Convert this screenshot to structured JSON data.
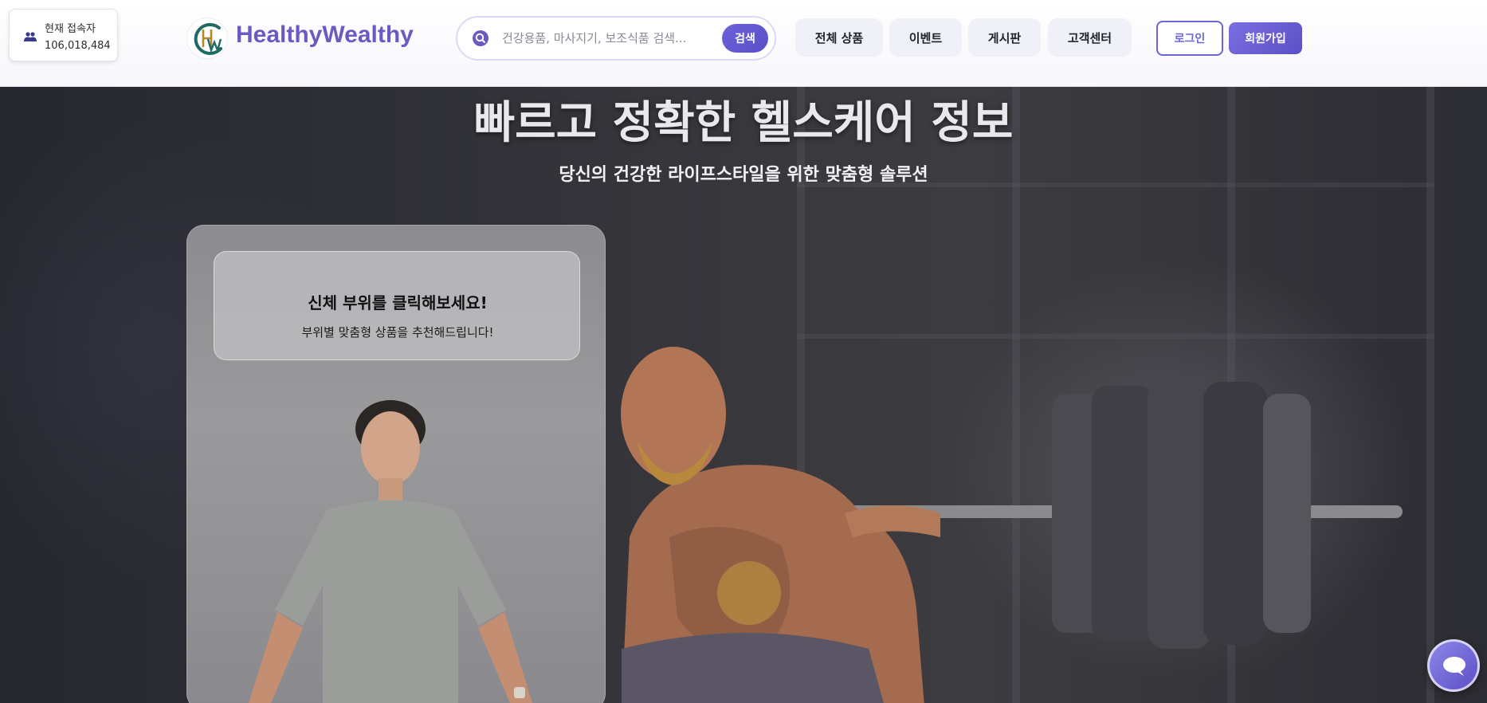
{
  "visitor": {
    "label": "현재 접속자",
    "count": "106,018,484",
    "icon": "users-icon"
  },
  "brand": {
    "name": "HealthyWealthy",
    "logo": "hw-logo-icon",
    "accent": "#6a5bc4"
  },
  "search": {
    "placeholder": "건강용품, 마사지기, 보조식품 검색...",
    "button_label": "검색",
    "icon": "search-icon"
  },
  "nav": {
    "items": [
      {
        "label": "전체 상품"
      },
      {
        "label": "이벤트"
      },
      {
        "label": "게시판"
      },
      {
        "label": "고객센터"
      }
    ]
  },
  "auth": {
    "login_label": "로그인",
    "signup_label": "회원가입",
    "color": "#6a66d8"
  },
  "hero": {
    "title": "빠르고 정확한 헬스케어 정보",
    "subtitle": "당신의 건강한 라이프스타일을 위한 맞춤형 솔루션"
  },
  "body_panel": {
    "heading": "신체 부위를 클릭해보세요!",
    "description": "부위별 맞춤형 상품을 추천해드립니다!"
  },
  "chat": {
    "icon": "chat-bubble-icon"
  }
}
